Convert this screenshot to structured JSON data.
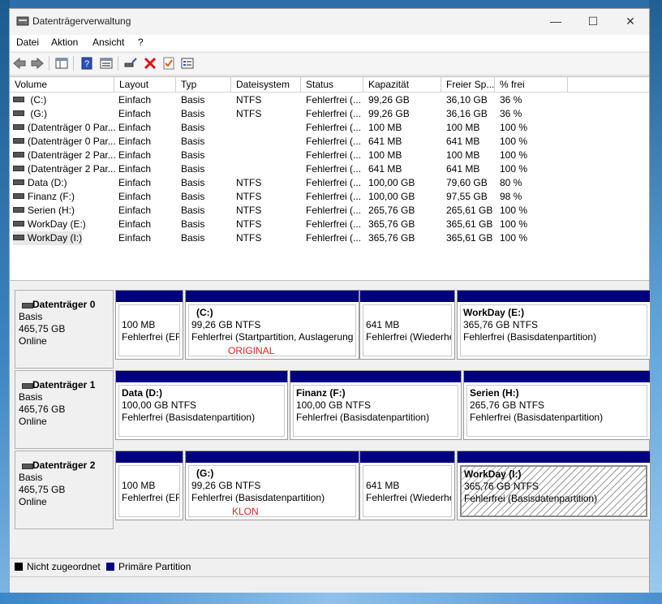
{
  "window": {
    "title": "Datenträgerverwaltung",
    "minimize": "—",
    "maximize": "☐",
    "close": "✕"
  },
  "menu": [
    "Datei",
    "Aktion",
    "Ansicht",
    "?"
  ],
  "toolbar": [
    "back-icon",
    "forward-icon",
    "console-tree-icon",
    "help-icon",
    "show-hide-icon",
    "connect-icon",
    "delete-icon",
    "check-icon",
    "properties-icon"
  ],
  "columns": [
    "Volume",
    "Layout",
    "Typ",
    "Dateisystem",
    "Status",
    "Kapazität",
    "Freier Sp...",
    "% frei"
  ],
  "volumes": [
    {
      "name": " (C:)",
      "layout": "Einfach",
      "type": "Basis",
      "fs": "NTFS",
      "status": "Fehlerfrei (...",
      "capacity": "99,26 GB",
      "free": "36,10 GB",
      "pct": "36 %"
    },
    {
      "name": " (G:)",
      "layout": "Einfach",
      "type": "Basis",
      "fs": "NTFS",
      "status": "Fehlerfrei (...",
      "capacity": "99,26 GB",
      "free": "36,16 GB",
      "pct": "36 %"
    },
    {
      "name": "(Datenträger 0 Par...",
      "layout": "Einfach",
      "type": "Basis",
      "fs": "",
      "status": "Fehlerfrei (...",
      "capacity": "100 MB",
      "free": "100 MB",
      "pct": "100 %"
    },
    {
      "name": "(Datenträger 0 Par...",
      "layout": "Einfach",
      "type": "Basis",
      "fs": "",
      "status": "Fehlerfrei (...",
      "capacity": "641 MB",
      "free": "641 MB",
      "pct": "100 %"
    },
    {
      "name": "(Datenträger 2 Par...",
      "layout": "Einfach",
      "type": "Basis",
      "fs": "",
      "status": "Fehlerfrei (...",
      "capacity": "100 MB",
      "free": "100 MB",
      "pct": "100 %"
    },
    {
      "name": "(Datenträger 2 Par...",
      "layout": "Einfach",
      "type": "Basis",
      "fs": "",
      "status": "Fehlerfrei (...",
      "capacity": "641 MB",
      "free": "641 MB",
      "pct": "100 %"
    },
    {
      "name": "Data (D:)",
      "layout": "Einfach",
      "type": "Basis",
      "fs": "NTFS",
      "status": "Fehlerfrei (...",
      "capacity": "100,00 GB",
      "free": "79,60 GB",
      "pct": "80 %"
    },
    {
      "name": "Finanz (F:)",
      "layout": "Einfach",
      "type": "Basis",
      "fs": "NTFS",
      "status": "Fehlerfrei (...",
      "capacity": "100,00 GB",
      "free": "97,55 GB",
      "pct": "98 %"
    },
    {
      "name": "Serien (H:)",
      "layout": "Einfach",
      "type": "Basis",
      "fs": "NTFS",
      "status": "Fehlerfrei (...",
      "capacity": "265,76 GB",
      "free": "265,61 GB",
      "pct": "100 %"
    },
    {
      "name": "WorkDay (E:)",
      "layout": "Einfach",
      "type": "Basis",
      "fs": "NTFS",
      "status": "Fehlerfrei (...",
      "capacity": "365,76 GB",
      "free": "365,61 GB",
      "pct": "100 %"
    },
    {
      "name": "WorkDay (I:)",
      "layout": "Einfach",
      "type": "Basis",
      "fs": "NTFS",
      "status": "Fehlerfrei (...",
      "capacity": "365,76 GB",
      "free": "365,61 GB",
      "pct": "100 %"
    }
  ],
  "disks": [
    {
      "name": "Datenträger 0",
      "type": "Basis",
      "size": "465,75 GB",
      "state": "Online",
      "partitions": [
        {
          "name": "",
          "size": "100 MB",
          "status": "Fehlerfrei (EFI"
        },
        {
          "name": "(C:)",
          "size": "99,26 GB NTFS",
          "status": "Fehlerfrei (Startpartition, Auslagerung"
        },
        {
          "name": "",
          "size": "641 MB",
          "status": "Fehlerfrei (Wiederhe"
        },
        {
          "name": "WorkDay  (E:)",
          "size": "365,76 GB NTFS",
          "status": "Fehlerfrei (Basisdatenpartition)"
        }
      ],
      "note": "ORIGINAL"
    },
    {
      "name": "Datenträger 1",
      "type": "Basis",
      "size": "465,76 GB",
      "state": "Online",
      "partitions": [
        {
          "name": "Data  (D:)",
          "size": "100,00 GB NTFS",
          "status": "Fehlerfrei (Basisdatenpartition)"
        },
        {
          "name": "Finanz  (F:)",
          "size": "100,00 GB NTFS",
          "status": "Fehlerfrei (Basisdatenpartition)"
        },
        {
          "name": "Serien  (H:)",
          "size": "265,76 GB NTFS",
          "status": "Fehlerfrei (Basisdatenpartition)"
        }
      ]
    },
    {
      "name": "Datenträger 2",
      "type": "Basis",
      "size": "465,75 GB",
      "state": "Online",
      "partitions": [
        {
          "name": "",
          "size": "100 MB",
          "status": "Fehlerfrei (EFI"
        },
        {
          "name": "(G:)",
          "size": "99,26 GB NTFS",
          "status": "Fehlerfrei (Basisdatenpartition)"
        },
        {
          "name": "",
          "size": "641 MB",
          "status": "Fehlerfrei (Wiederhe"
        },
        {
          "name": "WorkDay  (I:)",
          "size": "365,76 GB NTFS",
          "status": "Fehlerfrei (Basisdatenpartition)"
        }
      ],
      "note": "KLON"
    }
  ],
  "legend": {
    "unallocated": "Nicht zugeordnet",
    "primary": "Primäre Partition"
  },
  "colors": {
    "primary": "#00007f",
    "unallocated": "#000000",
    "note": "#dd2222"
  }
}
